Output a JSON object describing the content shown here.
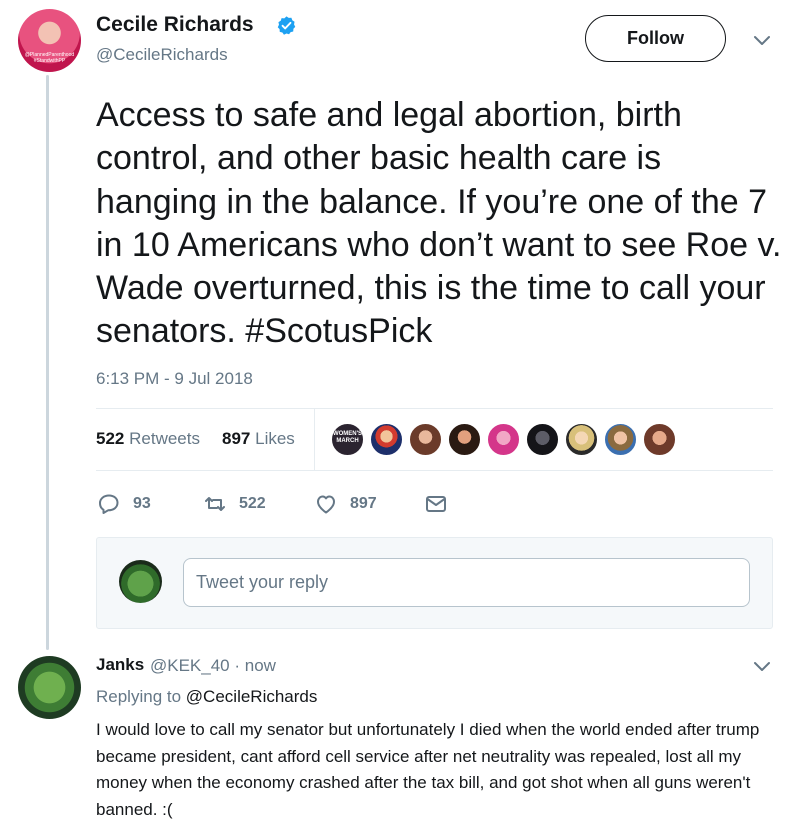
{
  "author": {
    "name": "Cecile Richards",
    "handle": "@CecileRichards",
    "avatar_caption": "@PlannedParenthood #StandwithPP"
  },
  "follow_label": "Follow",
  "tweet": {
    "text": "Access to safe and legal abortion, birth control, and other basic health care is hanging in the balance. If you’re one of the 7 in 10 Americans who don’t want to see Roe v. Wade overturned, this is the time to call your senators. #ScotusPick",
    "timestamp": "6:13 PM - 9 Jul 2018"
  },
  "stats": {
    "retweets_count": "522",
    "retweets_label": "Retweets",
    "likes_count": "897",
    "likes_label": "Likes"
  },
  "likers_badge_text": "WOMEN'S MARCH",
  "actions": {
    "replies": "93",
    "retweets": "522",
    "likes": "897"
  },
  "reply_box": {
    "placeholder": "Tweet your reply"
  },
  "reply": {
    "name": "Janks",
    "handle": "@KEK_40",
    "time": "now",
    "replying_prefix": "Replying to",
    "replying_to": "@CecileRichards",
    "text": "I would love to call my senator but unfortunately I died when the world ended after trump became president, cant afford cell service after net neutrality was repealed, lost all my money when the economy crashed after the tax bill, and got shot when all guns weren't banned. :("
  },
  "colors": {
    "verified": "#1da1f2",
    "secondary_text": "#657786",
    "primary_text": "#14171a"
  }
}
